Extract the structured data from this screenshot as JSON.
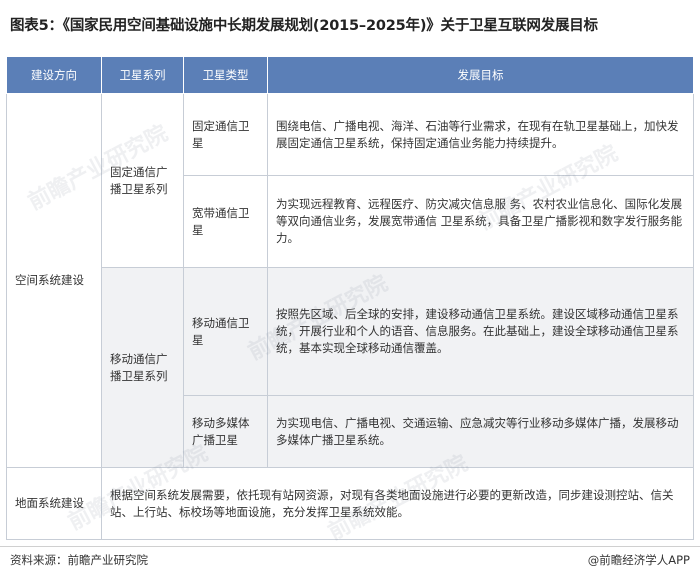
{
  "title": "图表5：《国家民用空间基础设施中长期发展规划(2015–2025年)》关于卫星互联网发展目标",
  "headers": [
    "建设方向",
    "卫星系列",
    "卫星类型",
    "发展目标"
  ],
  "rows": {
    "space": {
      "direction": "空间系统建设",
      "fixed": {
        "series": "固定通信广播卫星系列",
        "t1": "固定通信卫星",
        "g1": "围绕电信、广播电视、海洋、石油等行业需求，在现有在轨卫星基础上，加快发展固定通信卫星系统，保持固定通信业务能力持续提升。",
        "t2": "宽带通信卫星",
        "g2": "为实现远程教育、远程医疗、防灾减灾信息服 务、农村农业信息化、国际化发展等双向通信业务，发展宽带通信 卫星系统，具备卫星广播影视和数字发行服务能力。"
      },
      "mobile": {
        "series": "移动通信广播卫星系列",
        "t1": "移动通信卫星",
        "g1": "按照先区域、后全球的安排，建设移动通信卫星系统。建设区域移动通信卫星系统，开展行业和个人的语音、信息服务。在此基础上，建设全球移动通信卫星系统，基本实现全球移动通信覆盖。",
        "t2": "移动多媒体广播卫星",
        "g2": "为实现电信、广播电视、交通运输、应急减灾等行业移动多媒体广播，发展移动多媒体广播卫星系统。"
      }
    },
    "ground": {
      "direction": "地面系统建设",
      "goal": "根据空间系统发展需要，依托现有站网资源，对现有各类地面设施进行必要的更新改造，同步建设测控站、信关站、上行站、标校场等地面设施，充分发挥卫星系统效能。"
    }
  },
  "watermark": "前瞻产业研究院",
  "source": "资料来源：前瞻产业研究院",
  "brand": "@前瞻经济学人APP"
}
